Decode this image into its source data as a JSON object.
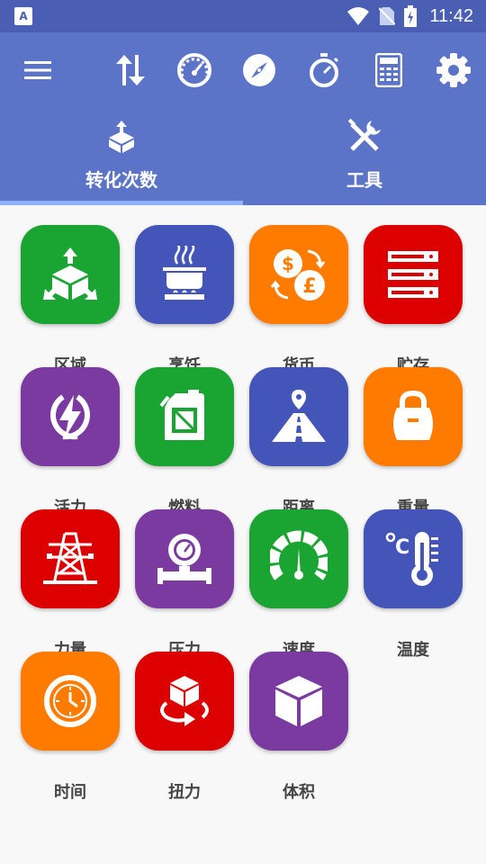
{
  "status_bar": {
    "time": "11:42",
    "app_badge": "A"
  },
  "toolbar": {
    "icons": [
      "menu-icon",
      "swap-icon",
      "speedometer-icon",
      "compass-icon",
      "stopwatch-icon",
      "calculator-icon",
      "settings-icon"
    ]
  },
  "tabs": [
    {
      "label": "转化次数",
      "icon": "convert-icon",
      "selected": true
    },
    {
      "label": "工具",
      "icon": "tools-icon",
      "selected": false
    }
  ],
  "colors": {
    "status_bar": "#4a5fb3",
    "toolbar": "#5b74c8",
    "tab_indicator": "#8fb2ff",
    "green": "#1aa532",
    "blue": "#4355b8",
    "orange": "#ff7b00",
    "red": "#dd0000",
    "purple": "#7b3aa0"
  },
  "categories": [
    {
      "label": "区域",
      "icon": "area-icon",
      "color": "#1aa532"
    },
    {
      "label": "烹饪",
      "icon": "cooking-icon",
      "color": "#4355b8"
    },
    {
      "label": "货币",
      "icon": "currency-icon",
      "color": "#ff7b00"
    },
    {
      "label": "贮存",
      "icon": "storage-icon",
      "color": "#dd0000"
    },
    {
      "label": "活力",
      "icon": "energy-icon",
      "color": "#7b3aa0"
    },
    {
      "label": "燃料",
      "icon": "fuel-icon",
      "color": "#1aa532"
    },
    {
      "label": "距离",
      "icon": "distance-icon",
      "color": "#4355b8"
    },
    {
      "label": "重量",
      "icon": "weight-icon",
      "color": "#ff7b00"
    },
    {
      "label": "力量",
      "icon": "power-icon",
      "color": "#dd0000"
    },
    {
      "label": "压力",
      "icon": "pressure-icon",
      "color": "#7b3aa0"
    },
    {
      "label": "速度",
      "icon": "speed-icon",
      "color": "#1aa532"
    },
    {
      "label": "温度",
      "icon": "temperature-icon",
      "color": "#4355b8"
    },
    {
      "label": "时间",
      "icon": "time-icon",
      "color": "#ff7b00"
    },
    {
      "label": "扭力",
      "icon": "torque-icon",
      "color": "#dd0000"
    },
    {
      "label": "体积",
      "icon": "volume-icon",
      "color": "#7b3aa0"
    }
  ]
}
